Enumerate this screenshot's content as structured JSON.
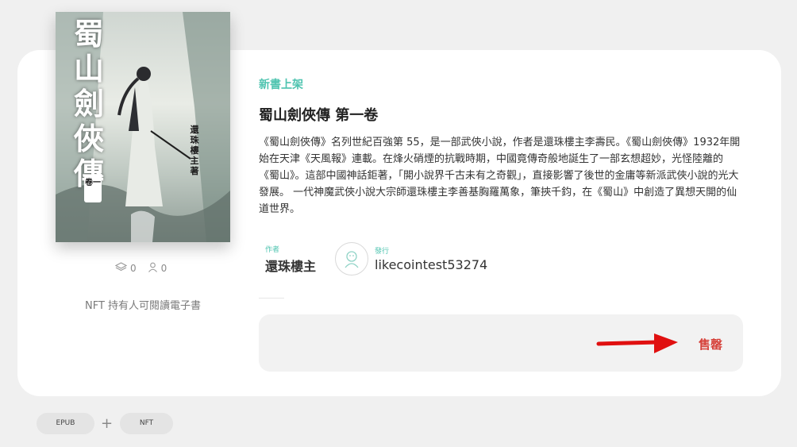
{
  "book": {
    "cover_title": "蜀山劍俠傳",
    "cover_author": "還珠樓主著",
    "cover_volume": "卷一",
    "status_label": "新書上架",
    "title": "蜀山劍俠傳 第一卷",
    "description": "《蜀山劍俠傳》名列世紀百強第 55，是一部武俠小說，作者是還珠樓主李壽民。《蜀山劍俠傳》1932年開始在天津《天風報》連載。在烽火硝煙的抗戰時期，中國竟傳奇般地誕生了一部玄想超妙，光怪陸離的《蜀山》。這部中國神話鉅著，「開小說界千古未有之奇觀」，直接影響了後世的金庸等新派武俠小說的光大發展。 一代神魔武俠小說大宗師還珠樓主李善基胸羅萬象，筆挾千鈞，在《蜀山》中創造了異想天開的仙道世界。"
  },
  "stats": {
    "collected_count": "0",
    "owners_count": "0"
  },
  "nft_note": "NFT 持有人可閱讀電子書",
  "meta": {
    "author_label": "作者",
    "author_name": "還珠樓主",
    "publisher_label": "發行",
    "publisher_name": "likecointest53274"
  },
  "actions": {
    "sell_label": "售罄"
  },
  "formats": {
    "epub_label": "EPUB",
    "plus": "+",
    "nft_label": "NFT"
  },
  "colors": {
    "accent": "#4fc4b0",
    "sold_out": "#d6413a",
    "arrow": "#e01010"
  }
}
